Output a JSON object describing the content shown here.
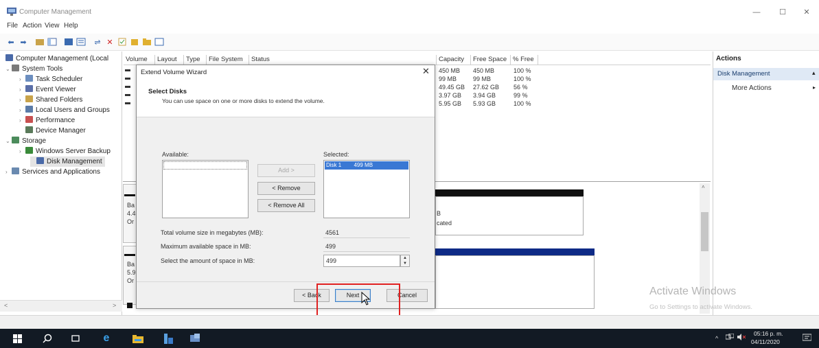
{
  "window": {
    "title": "Computer Management",
    "controls": {
      "minimize": "—",
      "maximize": "☐",
      "close": "✕"
    }
  },
  "menu": [
    "File",
    "Action",
    "View",
    "Help"
  ],
  "tree": {
    "root": "Computer Management (Local",
    "items": [
      {
        "label": "System Tools",
        "level": 1,
        "twist": "v",
        "color": "#7a7a7a"
      },
      {
        "label": "Task Scheduler",
        "level": 2,
        "twist": ">",
        "color": "#6c8ebf"
      },
      {
        "label": "Event Viewer",
        "level": 2,
        "twist": ">",
        "color": "#5b6fa8"
      },
      {
        "label": "Shared Folders",
        "level": 2,
        "twist": ">",
        "color": "#c9a34a"
      },
      {
        "label": "Local Users and Groups",
        "level": 2,
        "twist": ">",
        "color": "#5b7ba8"
      },
      {
        "label": "Performance",
        "level": 2,
        "twist": ">",
        "color": "#c85050"
      },
      {
        "label": "Device Manager",
        "level": 2,
        "twist": "",
        "color": "#5a7a5a"
      },
      {
        "label": "Storage",
        "level": 1,
        "twist": "v",
        "color": "#4c8c5c"
      },
      {
        "label": "Windows Server Backup",
        "level": 2,
        "twist": ">",
        "color": "#3a8a3a"
      },
      {
        "label": "Disk Management",
        "level": 2,
        "twist": "",
        "color": "#4a6aa8"
      },
      {
        "label": "Services and Applications",
        "level": 1,
        "twist": ">",
        "color": "#6a8ab0"
      }
    ],
    "scroll_left": "<",
    "scroll_right": ">"
  },
  "volume_table": {
    "headers": [
      "Volume",
      "Layout",
      "Type",
      "File System",
      "Status",
      "Capacity",
      "Free Space",
      "% Free"
    ],
    "rows": [
      {
        "capacity": "450 MB",
        "free": "450 MB",
        "pct": "100 %"
      },
      {
        "capacity": "99 MB",
        "free": "99 MB",
        "pct": "100 %"
      },
      {
        "capacity": "49.45 GB",
        "free": "27.62 GB",
        "pct": "56 %"
      },
      {
        "capacity": "3.97 GB",
        "free": "3.94 GB",
        "pct": "99 %"
      },
      {
        "capacity": "5.95 GB",
        "free": "5.93 GB",
        "pct": "100 %"
      }
    ]
  },
  "disk_pane": {
    "disk0_fragments": [
      "Ba",
      "4.4",
      "Or"
    ],
    "disk1_fragments": [
      "Ba",
      "5.9",
      "Or"
    ],
    "partition_fragments": [
      "B",
      "cated"
    ]
  },
  "actions": {
    "title": "Actions",
    "section": "Disk Management",
    "more": "More Actions"
  },
  "dialog": {
    "title": "Extend Volume Wizard",
    "close": "✕",
    "heading": "Select Disks",
    "subtitle": "You can use space on one or more disks to extend the volume.",
    "available_label": "Available:",
    "selected_label": "Selected:",
    "selected_item": {
      "disk": "Disk 1",
      "size": "499 MB"
    },
    "add_button": "Add >",
    "remove_button": "< Remove",
    "remove_all_button": "< Remove All",
    "total_label": "Total volume size in megabytes (MB):",
    "total_value": "4561",
    "max_label": "Maximum available space in MB:",
    "max_value": "499",
    "amount_label": "Select the amount of space in MB:",
    "amount_value": "499",
    "back_button": "< Back",
    "next_button": "Next",
    "cancel_button": "Cancel"
  },
  "watermark": {
    "line1": "Activate Windows",
    "line2": "Go to Settings to activate Windows."
  },
  "taskbar": {
    "time": "05:16 p. m.",
    "date": "04/11/2020"
  },
  "colors": {
    "highlight": "#e02020",
    "selection_blue": "#3a78d4",
    "disk_blue": "#0e2a86"
  }
}
